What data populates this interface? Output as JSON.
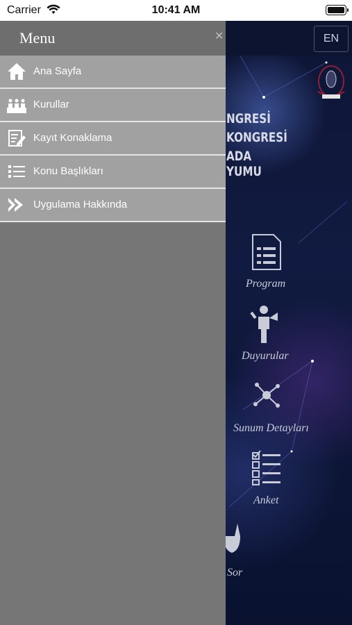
{
  "status_bar": {
    "carrier": "Carrier",
    "time": "10:41 AM"
  },
  "header": {
    "language_button": "EN"
  },
  "congress_title": {
    "line1": "NGRESİ",
    "line2": "KONGRESİ",
    "line3": "ADA",
    "line4": "YUMU"
  },
  "background_menu": {
    "program": "Program",
    "duyurular": "Duyurular",
    "sunum": "Sunum Detayları",
    "anket": "Anket",
    "sor": "Sor"
  },
  "drawer": {
    "title": "Menu",
    "items": [
      {
        "label": "Ana Sayfa",
        "icon": "home-icon"
      },
      {
        "label": "Kurullar",
        "icon": "people-icon"
      },
      {
        "label": "Kayıt Konaklama",
        "icon": "form-edit-icon"
      },
      {
        "label": "Konu Başlıkları",
        "icon": "list-icon"
      },
      {
        "label": "Uygulama Hakkında",
        "icon": "double-chevron-icon"
      }
    ]
  },
  "colors": {
    "drawer_bg": "#767676",
    "menu_item_bg": "#a1a1a1",
    "background": "#0e1636"
  }
}
